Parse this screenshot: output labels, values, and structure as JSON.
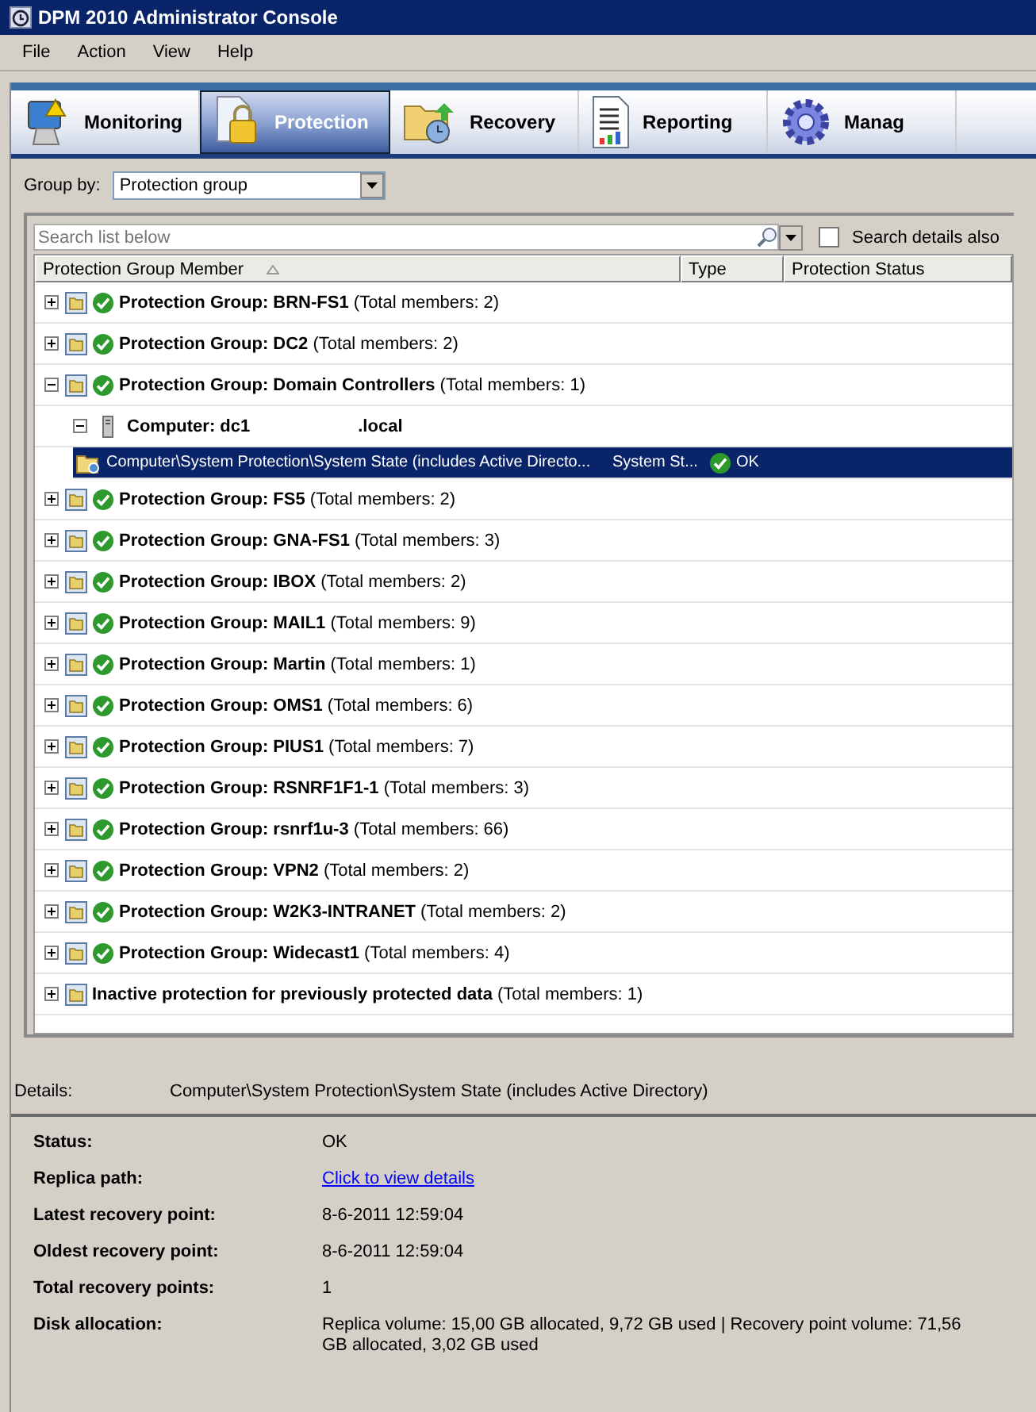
{
  "window": {
    "title": "DPM 2010 Administrator Console"
  },
  "menu": [
    "File",
    "Action",
    "View",
    "Help"
  ],
  "tabs": [
    {
      "label": "Monitoring",
      "selected": false,
      "kind": "monitor"
    },
    {
      "label": "Protection",
      "selected": true,
      "kind": "lock"
    },
    {
      "label": "Recovery",
      "selected": false,
      "kind": "folder"
    },
    {
      "label": "Reporting",
      "selected": false,
      "kind": "report"
    },
    {
      "label": "Manag",
      "selected": false,
      "kind": "gear"
    }
  ],
  "group_by": {
    "label": "Group by:",
    "value": "Protection group"
  },
  "search": {
    "placeholder": "Search list below",
    "details_label": "Search details also",
    "details_checked": false
  },
  "table": {
    "columns": [
      "Protection Group Member",
      "Type",
      "Protection Status"
    ],
    "rows": [
      {
        "kind": "group",
        "name": "Protection Group: BRN-FS1",
        "count": "(Total members: 2)",
        "expanded": false,
        "selected": false
      },
      {
        "kind": "group",
        "name": "Protection Group: DC2",
        "count": "(Total members: 2)",
        "expanded": false,
        "selected": false
      },
      {
        "kind": "group",
        "name": "Protection Group: Domain Controllers",
        "count": "(Total members: 1)",
        "expanded": true,
        "selected": false,
        "children": [
          {
            "kind": "computer",
            "name": "Computer: dc1",
            "suffix": ".local",
            "expanded": true,
            "selected": false,
            "children": [
              {
                "kind": "member",
                "name": "Computer\\System Protection\\System State (includes Active Directo...",
                "type": "System St...",
                "status": "OK",
                "selected": true
              }
            ]
          }
        ]
      },
      {
        "kind": "group",
        "name": "Protection Group: FS5",
        "count": "(Total members: 2)",
        "expanded": false,
        "selected": false
      },
      {
        "kind": "group",
        "name": "Protection Group: GNA-FS1",
        "count": "(Total members: 3)",
        "expanded": false,
        "selected": false
      },
      {
        "kind": "group",
        "name": "Protection Group: IBOX",
        "count": "(Total members: 2)",
        "expanded": false,
        "selected": false
      },
      {
        "kind": "group",
        "name": "Protection Group: MAIL1",
        "count": "(Total members: 9)",
        "expanded": false,
        "selected": false
      },
      {
        "kind": "group",
        "name": "Protection Group: Martin",
        "count": "(Total members: 1)",
        "expanded": false,
        "selected": false
      },
      {
        "kind": "group",
        "name": "Protection Group: OMS1",
        "count": "(Total members: 6)",
        "expanded": false,
        "selected": false
      },
      {
        "kind": "group",
        "name": "Protection Group: PIUS1",
        "count": "(Total members: 7)",
        "expanded": false,
        "selected": false
      },
      {
        "kind": "group",
        "name": "Protection Group: RSNRF1F1-1",
        "count": "(Total members: 3)",
        "expanded": false,
        "selected": false
      },
      {
        "kind": "group",
        "name": "Protection Group: rsnrf1u-3",
        "count": "(Total members: 66)",
        "expanded": false,
        "selected": false
      },
      {
        "kind": "group",
        "name": "Protection Group: VPN2",
        "count": "(Total members: 2)",
        "expanded": false,
        "selected": false
      },
      {
        "kind": "group",
        "name": "Protection Group: W2K3-INTRANET",
        "count": "(Total members: 2)",
        "expanded": false,
        "selected": false
      },
      {
        "kind": "group",
        "name": "Protection Group: Widecast1",
        "count": "(Total members: 4)",
        "expanded": false,
        "selected": false
      },
      {
        "kind": "inactive",
        "name": "Inactive protection for previously protected data",
        "count": "(Total members: 1)",
        "expanded": false,
        "selected": false
      }
    ]
  },
  "details": {
    "label": "Details:",
    "value": "Computer\\System Protection\\System State (includes Active Directory)",
    "fields": [
      {
        "label": "Status:",
        "value": "OK",
        "kind": "text"
      },
      {
        "label": "Replica path:",
        "value": "Click to view details",
        "kind": "link"
      },
      {
        "label": "Latest recovery point:",
        "value": "8-6-2011 12:59:04",
        "kind": "text"
      },
      {
        "label": "Oldest recovery point:",
        "value": "8-6-2011 12:59:04",
        "kind": "text"
      },
      {
        "label": "Total recovery points:",
        "value": "1",
        "kind": "text"
      },
      {
        "label": "Disk allocation:",
        "value": "Replica volume: 15,00 GB allocated, 9,72 GB used | Recovery point volume: 71,56 GB allocated, 3,02 GB used",
        "kind": "text"
      }
    ]
  }
}
